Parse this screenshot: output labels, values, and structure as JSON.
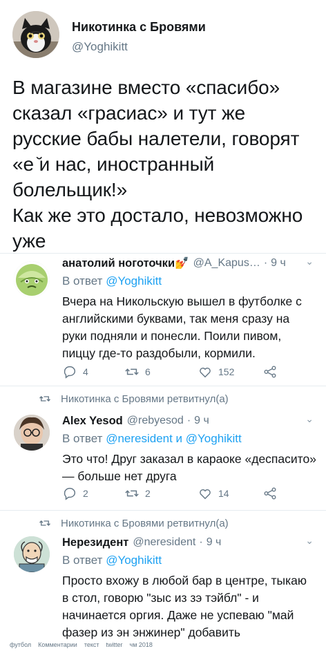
{
  "main": {
    "name": "Никотинка с Бровями",
    "handle": "@Yoghikitt",
    "paragraph1": "В магазине вместо «спасибо» сказал «грасиас» и тут же русские бабы налетели, говорят «е ̆и нас, иностранный болельщик!»",
    "paragraph2": "Как же это достало, невозможно уже"
  },
  "tweets": [
    {
      "name": "анатолий ноготочки💅",
      "handle": "@A_Kapus…",
      "time": "9 ч",
      "reply_prefix": "В ответ",
      "reply_to": "@Yoghikitt",
      "text": "Вчера на Никольскую вышел в футболке с английскими буквами, так меня сразу на руки подняли и понесли. Поили пивом, пиццу где-то раздобыли, кормили.",
      "replies": "4",
      "retweets": "6",
      "likes": "152"
    },
    {
      "retweeted_by": "Никотинка с Бровями ретвитнул(а)",
      "name": "Alex Yesod",
      "handle": "@rebyesod",
      "time": "9 ч",
      "reply_prefix": "В ответ",
      "reply_to": "@neresident и @Yoghikitt",
      "text": "Это что! Друг заказал в караоке «деспасито» — больше нет друга",
      "replies": "2",
      "retweets": "2",
      "likes": "14"
    },
    {
      "retweeted_by": "Никотинка с Бровями ретвитнул(а)",
      "name": "Нерезидент",
      "handle": "@neresident",
      "time": "9 ч",
      "reply_prefix": "В ответ",
      "reply_to": "@Yoghikitt",
      "text": "Просто вхожу в любой бар в центре, тыкаю в стол, говорю \"зыс из зэ тэйбл\" - и начинается оргия. Даже не успеваю \"май фазер из эн энжинер\" добавить"
    }
  ],
  "footer": [
    "футбол",
    "Комментарии",
    "текст",
    "twitter",
    "чм 2018"
  ],
  "colors": {
    "link": "#1da1f2",
    "muted": "#657786",
    "text": "#14171a"
  }
}
